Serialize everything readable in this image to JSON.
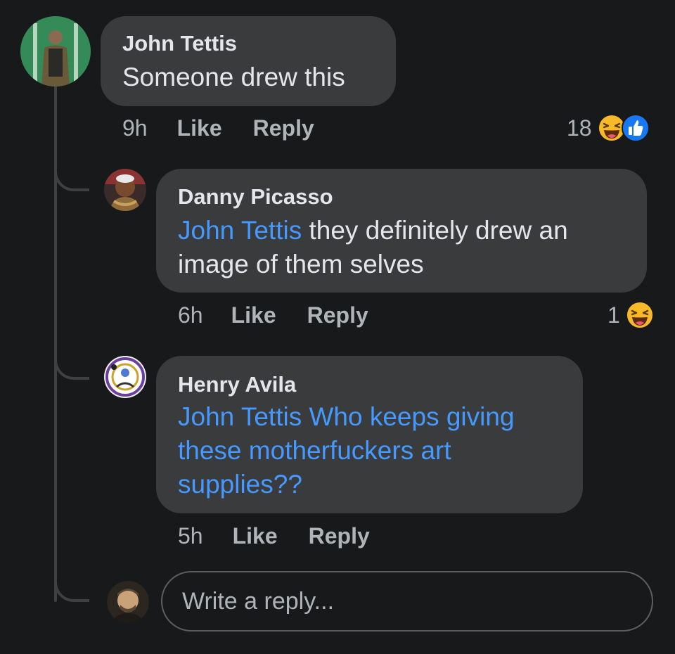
{
  "comment": {
    "author": "John Tettis",
    "text": "Someone drew this",
    "time": "9h",
    "like_label": "Like",
    "reply_label": "Reply",
    "reaction_count": "18",
    "reaction_icons": [
      "laugh-icon",
      "like-thumb-icon"
    ]
  },
  "replies": [
    {
      "author": "Danny Picasso",
      "mention": "John Tettis",
      "text_line1": " they definitely drew an",
      "text_line2": "image of them selves",
      "time": "6h",
      "like_label": "Like",
      "reply_label": "Reply",
      "reaction_count": "1",
      "reaction_icons": [
        "laugh-icon"
      ]
    },
    {
      "author": "Henry Avila",
      "mention": "John Tettis",
      "text_line1": " Who keeps giving",
      "text_line2": "these motherfuckers art",
      "text_line3": "supplies??",
      "time": "5h",
      "like_label": "Like",
      "reply_label": "Reply"
    }
  ],
  "reply_input": {
    "placeholder": "Write a reply..."
  },
  "colors": {
    "background": "#18191a",
    "bubble": "#3a3b3c",
    "mention": "#4599ff",
    "muted_text": "#b0b3b8",
    "like_blue": "#1877f2",
    "laugh_yellow": "#f7b928"
  }
}
